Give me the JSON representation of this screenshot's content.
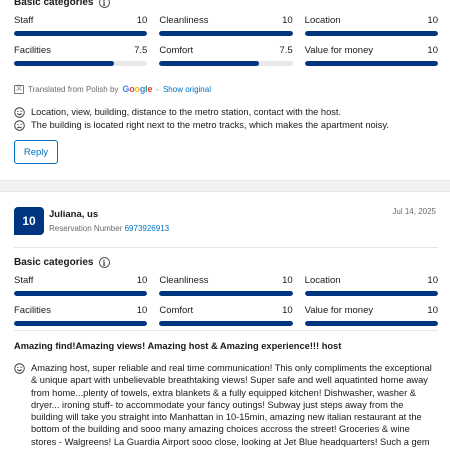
{
  "review1": {
    "categories_heading": "Basic categories",
    "categories": [
      {
        "label": "Staff",
        "score": "10",
        "fill": 1.0
      },
      {
        "label": "Cleanliness",
        "score": "10",
        "fill": 1.0
      },
      {
        "label": "Location",
        "score": "10",
        "fill": 1.0
      },
      {
        "label": "Facilities",
        "score": "7.5",
        "fill": 0.75
      },
      {
        "label": "Comfort",
        "score": "7.5",
        "fill": 0.75
      },
      {
        "label": "Value for money",
        "score": "10",
        "fill": 1.0
      }
    ],
    "translated_prefix": "Translated from Polish by",
    "google_letters": [
      "G",
      "o",
      "o",
      "g",
      "l",
      "e"
    ],
    "translated_sep": "-",
    "show_original": "Show original",
    "liked": "Location, view, building, distance to the metro station, contact with the host.",
    "disliked": "The building is located right next to the metro tracks, which makes the apartment noisy.",
    "reply_label": "Reply"
  },
  "review2": {
    "score": "10",
    "reviewer": "Juliana, us",
    "reservation_label": "Reservation Number",
    "reservation_number": "6973926913",
    "date": "Jul 14, 2025",
    "categories_heading": "Basic categories",
    "categories": [
      {
        "label": "Staff",
        "score": "10",
        "fill": 1.0
      },
      {
        "label": "Cleanliness",
        "score": "10",
        "fill": 1.0
      },
      {
        "label": "Location",
        "score": "10",
        "fill": 1.0
      },
      {
        "label": "Facilities",
        "score": "10",
        "fill": 1.0
      },
      {
        "label": "Comfort",
        "score": "10",
        "fill": 1.0
      },
      {
        "label": "Value for money",
        "score": "10",
        "fill": 1.0
      }
    ],
    "title": "Amazing find!Amazing views! Amazing host & Amazing experience!!! host",
    "liked": "Amazing host, super reliable and real time communication! This only compliments the exceptional & unique apart with unbelievable breathtaking views! Super safe and well aquatinted home away from home...plenty of towels, extra blankets & a fully equipped kitchen! Dishwasher, washer & dryer... ironing stuff- to accommodate your fancy outings! Subway just steps away from the building will take you straight into Manhattan in 10-15min, amazing new italian restaurant at the bottom of the building and sooo many amazing choices accross the street! Groceries & wine stores - Walgreens! La Guardia Airport sooo close, looking at Jet Blue headquarters! Such a gem and a great find, new"
  },
  "colors": {
    "bar_fill": "#003580",
    "bar_track": "#e8e8e8",
    "link": "#0071c2",
    "score_badge": "#003580"
  },
  "icons": {
    "info": "info-icon",
    "translate": "translate-icon",
    "liked": "smiley-face-icon",
    "disliked": "frowning-face-icon"
  }
}
